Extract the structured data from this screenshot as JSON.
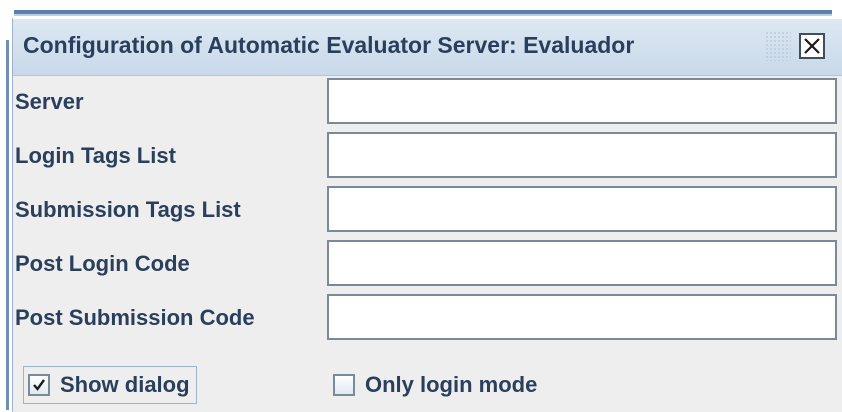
{
  "dialog": {
    "title": "Configuration of Automatic Evaluator Server: Evaluador",
    "close_icon": "close-x-icon"
  },
  "fields": [
    {
      "label": "Server",
      "value": ""
    },
    {
      "label": "Login Tags List",
      "value": ""
    },
    {
      "label": "Submission Tags List",
      "value": ""
    },
    {
      "label": "Post Login Code",
      "value": ""
    },
    {
      "label": "Post Submission Code",
      "value": ""
    }
  ],
  "options": {
    "show_dialog": {
      "label": "Show dialog",
      "checked": true
    },
    "only_login_mode": {
      "label": "Only login mode",
      "checked": false
    }
  },
  "colors": {
    "label_text": "#2a3f5c",
    "title_bar": "#c8d9ea",
    "panel_bg": "#eeeeee"
  }
}
